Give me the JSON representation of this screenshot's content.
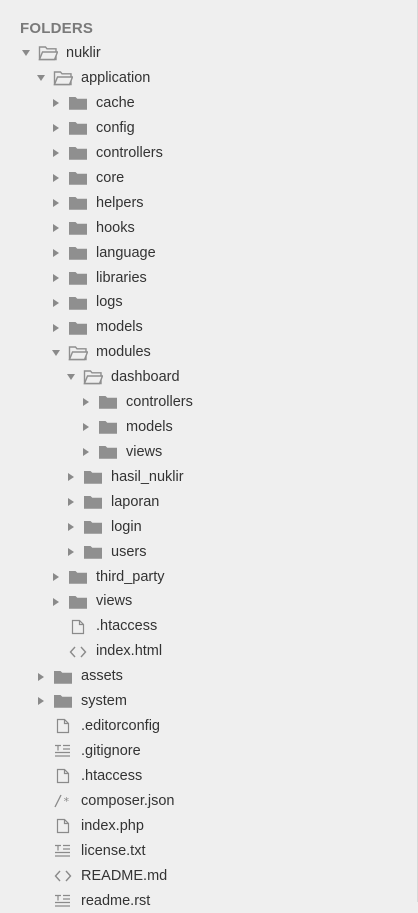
{
  "sidebar": {
    "header": "FOLDERS",
    "items": [
      {
        "label": "nuklir",
        "type": "folder",
        "open": true,
        "level": 0
      },
      {
        "label": "application",
        "type": "folder",
        "open": true,
        "level": 1
      },
      {
        "label": "cache",
        "type": "folder",
        "open": false,
        "level": 2
      },
      {
        "label": "config",
        "type": "folder",
        "open": false,
        "level": 2
      },
      {
        "label": "controllers",
        "type": "folder",
        "open": false,
        "level": 2
      },
      {
        "label": "core",
        "type": "folder",
        "open": false,
        "level": 2
      },
      {
        "label": "helpers",
        "type": "folder",
        "open": false,
        "level": 2
      },
      {
        "label": "hooks",
        "type": "folder",
        "open": false,
        "level": 2
      },
      {
        "label": "language",
        "type": "folder",
        "open": false,
        "level": 2
      },
      {
        "label": "libraries",
        "type": "folder",
        "open": false,
        "level": 2
      },
      {
        "label": "logs",
        "type": "folder",
        "open": false,
        "level": 2
      },
      {
        "label": "models",
        "type": "folder",
        "open": false,
        "level": 2
      },
      {
        "label": "modules",
        "type": "folder",
        "open": true,
        "level": 2
      },
      {
        "label": "dashboard",
        "type": "folder",
        "open": true,
        "level": 3
      },
      {
        "label": "controllers",
        "type": "folder",
        "open": false,
        "level": 4
      },
      {
        "label": "models",
        "type": "folder",
        "open": false,
        "level": 4
      },
      {
        "label": "views",
        "type": "folder",
        "open": false,
        "level": 4
      },
      {
        "label": "hasil_nuklir",
        "type": "folder",
        "open": false,
        "level": 3
      },
      {
        "label": "laporan",
        "type": "folder",
        "open": false,
        "level": 3
      },
      {
        "label": "login",
        "type": "folder",
        "open": false,
        "level": 3
      },
      {
        "label": "users",
        "type": "folder",
        "open": false,
        "level": 3
      },
      {
        "label": "third_party",
        "type": "folder",
        "open": false,
        "level": 2
      },
      {
        "label": "views",
        "type": "folder",
        "open": false,
        "level": 2
      },
      {
        "label": ".htaccess",
        "type": "file",
        "icon": "file-icon",
        "level": 2
      },
      {
        "label": "index.html",
        "type": "file",
        "icon": "code-icon",
        "level": 2
      },
      {
        "label": "assets",
        "type": "folder",
        "open": false,
        "level": 1
      },
      {
        "label": "system",
        "type": "folder",
        "open": false,
        "level": 1
      },
      {
        "label": ".editorconfig",
        "type": "file",
        "icon": "file-icon",
        "level": 1
      },
      {
        "label": ".gitignore",
        "type": "file",
        "icon": "text-lines-icon",
        "level": 1
      },
      {
        "label": ".htaccess",
        "type": "file",
        "icon": "file-icon",
        "level": 1
      },
      {
        "label": "composer.json",
        "type": "file",
        "icon": "comment-icon",
        "level": 1
      },
      {
        "label": "index.php",
        "type": "file",
        "icon": "file-icon",
        "level": 1
      },
      {
        "label": "license.txt",
        "type": "file",
        "icon": "text-lines-icon",
        "level": 1
      },
      {
        "label": "README.md",
        "type": "file",
        "icon": "code-icon",
        "level": 1
      },
      {
        "label": "readme.rst",
        "type": "file",
        "icon": "text-lines-icon",
        "level": 1
      }
    ]
  },
  "colors": {
    "folder": "#8f8f8f",
    "background": "#efefef",
    "text": "#333333",
    "header": "#7a7a7a"
  }
}
